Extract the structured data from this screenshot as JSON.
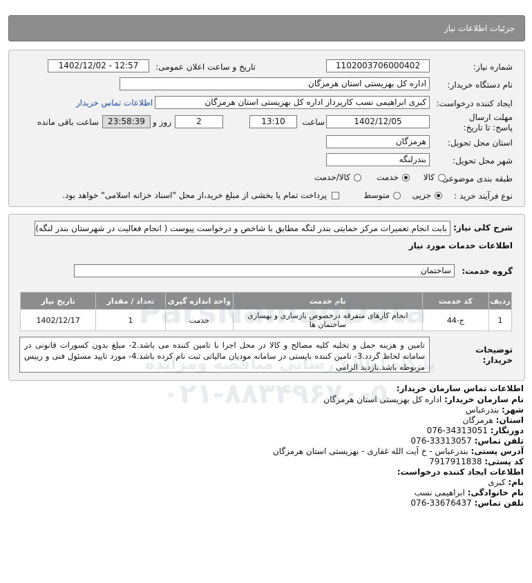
{
  "header": {
    "title": "جزئیات اطلاعات نیاز"
  },
  "form": {
    "need_number_label": "شماره نیاز:",
    "need_number": "1102003706000402",
    "announce_label": "تاریخ و ساعت اعلان عمومی:",
    "announce_value": "1402/12/02 - 12:57",
    "buyer_org_label": "نام دستگاه خریدار:",
    "buyer_org": "اداره کل بهزیستی استان هرمزگان",
    "creator_label": "ایجاد کننده درخواست:",
    "creator": "کبری  ابراهیمی نسب کارپرداز اداره کل بهزیستی استان هرمزگان",
    "contact_link": "اطلاعات تماس خریدار",
    "deadline_label": "مهلت ارسال پاسخ: تا تاریخ:",
    "deadline_date": "1402/12/05",
    "time_label": "ساعت",
    "deadline_time": "13:10",
    "days": "2",
    "days_label": "روز و",
    "remaining": "23:58:39",
    "remaining_label": "ساعت باقی مانده",
    "province_label": "استان محل تحویل:",
    "province": "هرمزگان",
    "city_label": "شهر محل تحویل:",
    "city": "بندرلنگه",
    "category_label": "طبقه بندی موضوعی:",
    "category_options": [
      "کالا",
      "خدمت",
      "کالا/خدمت"
    ],
    "category_selected": "خدمت",
    "process_label": "نوع فرآیند خرید :",
    "process_options": [
      "جزیی",
      "متوسط"
    ],
    "process_selected": "جزیی",
    "payment_note": "پرداخت تمام یا بخشی از مبلغ خرید،از محل \"اسناد خزانه اسلامی\" خواهد بود."
  },
  "details": {
    "summary_label": "شرح کلی نیاز:",
    "summary": "بابت انجام تعمیرات مرکز حمایتی بندر لنگه مطابق با شاخص و درخواست پیوست ( انجام فعالیت در شهرستان بندر لنگه)",
    "services_heading": "اطلاعات خدمات مورد نیاز",
    "service_group_label": "گروه خدمت:",
    "service_group": "ساختمان",
    "table_headers": [
      "ردیف",
      "کد خدمت",
      "نام خدمت",
      "واحد اندازه گیری",
      "تعداد / مقدار",
      "تاریخ نیاز"
    ],
    "table_rows": [
      [
        "1",
        "ج-44",
        "انجام کارهای متفرقه درخصوص بازسازی و بهسازی ساختمان ها",
        "خدمت",
        "1",
        "1402/12/17"
      ]
    ],
    "notes_label": "توضیحات خریدار:",
    "notes": "تامین و هزینه حمل و تخلیه کلیه مصالح و کالا در محل اجرا با تامین کننده می باشد.2- مبلغ بدون کسورات قانونی در سامانه لحاظ گردد.3- تامین کننده بایستی در سامانه مودیان مالیاتی ثبت نام کرده باشد.4- مورد تایید مسئول فنی و رییس مربوطه باشد.بازدید الزامی"
  },
  "contact": {
    "heading": "اطلاعات تماس سازمان خریدار:",
    "org_label": "نام سازمان خریدار:",
    "org": "اداره کل بهزیستی استان هرمزگان",
    "city_label": "شهر:",
    "city": "بندرعباس",
    "province_label": "استان:",
    "province": "هرمزگان",
    "fax_label": "دورنگار:",
    "fax": "076-34313051",
    "phone_label": "تلفن تماس:",
    "phone": "076-33313057",
    "address_label": "آدرس پستی:",
    "address": "بندرعباس - خ آیت الله غفاری - بهزیستی استان هرمزگان",
    "postal_label": "کد پستی:",
    "postal": "7917911838",
    "creator_heading": "اطلاعات ایجاد کننده درخواست:",
    "name_label": "نام:",
    "name": "کبری",
    "family_label": "نام خانوادگی:",
    "family": "ابراهیمی نسب",
    "creator_phone_label": "تلفن تماس:",
    "creator_phone": "076-33676437"
  },
  "watermark": {
    "brand": "ParsNamadData",
    "subtitle": "پایگاه اطلاع رسانی مناقصه ومزایده",
    "phone": "۰۲۱-۸۸۳۴۹۶۷۰-۵"
  }
}
